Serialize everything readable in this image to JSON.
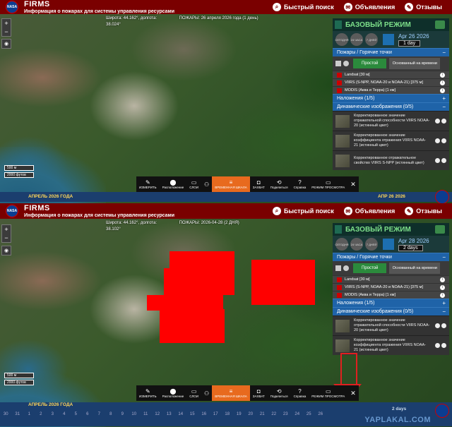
{
  "header": {
    "logo_text": "NASA",
    "title": "FIRMS",
    "subtitle": "Информация о пожарах для системы управления ресурсами",
    "quick_search": "Быстрый поиск",
    "announcements": "Объявления",
    "reviews": "Отзывы"
  },
  "shot1": {
    "coords": "Широта: 44.162°, долгота:",
    "coords2": "38.024°",
    "fires": "ПОЖАРЫ: 26 апреля 2026 года (1 день)",
    "scale_top": "500 м",
    "scale_bottom": "2000 футов",
    "timeline_label": "АПРЕЛЬ 2026 ГОДА",
    "timeline_right": "АПР 26 2026"
  },
  "shot2": {
    "coords": "Широта: 44.162°, долгота:",
    "coords2": "38.102°",
    "fires": "ПОЖАРЫ: 2026-04-28 (2 ДНЯ)",
    "scale_top": "500 м",
    "scale_bottom": "2000 футов",
    "timeline_label": "АПРЕЛЬ 2026 ГОДА",
    "timeline_right": "2 days",
    "watermark": "YAPLAKAL.COM",
    "ticks": [
      "30",
      "31",
      "1",
      "2",
      "3",
      "4",
      "5",
      "6",
      "7",
      "8",
      "9",
      "10",
      "11",
      "12",
      "13",
      "14",
      "15",
      "16",
      "17",
      "18",
      "19",
      "20",
      "21",
      "22",
      "23",
      "24",
      "25",
      "26"
    ]
  },
  "panel": {
    "title": "БАЗОВЫЙ РЕЖИМ",
    "date_btns": [
      "СЕГОДНЯ",
      "24 ЧАСА",
      "7 ДНЕЙ"
    ],
    "date1": "Apr 26 2026",
    "range1": "1 day",
    "date2": "Apr 28 2026",
    "range2": "2 days",
    "fires_section": "Пожары / Горячие точки",
    "simple": "Простой",
    "time_based": "Основанный на времени",
    "layers": [
      "Landsat [30 м]",
      "VIIRS (S-NPP, NOAA-20 и NOAA-21) [375 м]",
      "MODIS (Аква и Терра) [1 км]"
    ],
    "overlays": "Наложения (1/5)",
    "dynamic": "Динамические изображения (0/5)",
    "dyn_items": [
      "Корректированное значение отражательной способности VIIRS NOAA-20 (истинный цвет)",
      "Корректированное значение коэффициента отражения VIIRS NOAA-21 (истинный цвет)",
      "Корректированное отражательное свойство VIIRS S-NPP (истинный цвет)"
    ]
  },
  "toolbar": {
    "measure": "ИЗМЕРИТЬ",
    "location": "Расположение",
    "layers": "СЛОИ",
    "timeline": "ВРЕМЕННАЯ ШКАЛА",
    "capture": "ЗАХВАТ",
    "share": "Поделиться",
    "help": "Справка",
    "view_modes": "РЕЖИМ ПРОСМОТРА"
  }
}
